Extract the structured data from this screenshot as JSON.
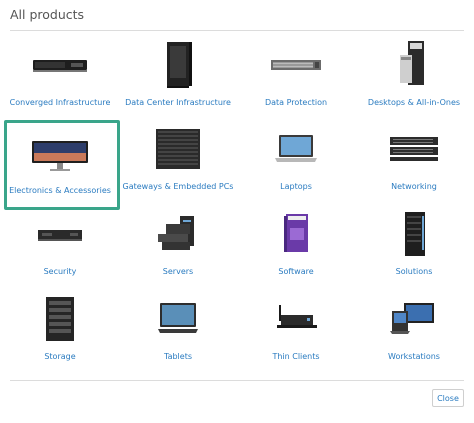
{
  "modal": {
    "title": "All products",
    "close_label": "Close"
  },
  "products": [
    {
      "label": "Converged Infrastructure",
      "icon": "rack-unit-icon"
    },
    {
      "label": "Data Center Infrastructure",
      "icon": "server-rack-icon"
    },
    {
      "label": "Data Protection",
      "icon": "storage-appliance-icon"
    },
    {
      "label": "Desktops & All-in-Ones",
      "icon": "desktop-tower-icon"
    },
    {
      "label": "Electronics & Accessories",
      "icon": "monitor-icon",
      "selected": true
    },
    {
      "label": "Gateways & Embedded PCs",
      "icon": "gateway-box-icon"
    },
    {
      "label": "Laptops",
      "icon": "laptop-icon"
    },
    {
      "label": "Networking",
      "icon": "network-switch-icon"
    },
    {
      "label": "Security",
      "icon": "firewall-appliance-icon"
    },
    {
      "label": "Servers",
      "icon": "servers-icon"
    },
    {
      "label": "Software",
      "icon": "software-box-icon"
    },
    {
      "label": "Solutions",
      "icon": "solution-rack-icon"
    },
    {
      "label": "Storage",
      "icon": "storage-array-icon"
    },
    {
      "label": "Tablets",
      "icon": "tablet-icon"
    },
    {
      "label": "Thin Clients",
      "icon": "thin-client-icon"
    },
    {
      "label": "Workstations",
      "icon": "workstation-icon"
    }
  ],
  "colors": {
    "link": "#2a7bc0",
    "selection_border": "#3aa58a"
  }
}
